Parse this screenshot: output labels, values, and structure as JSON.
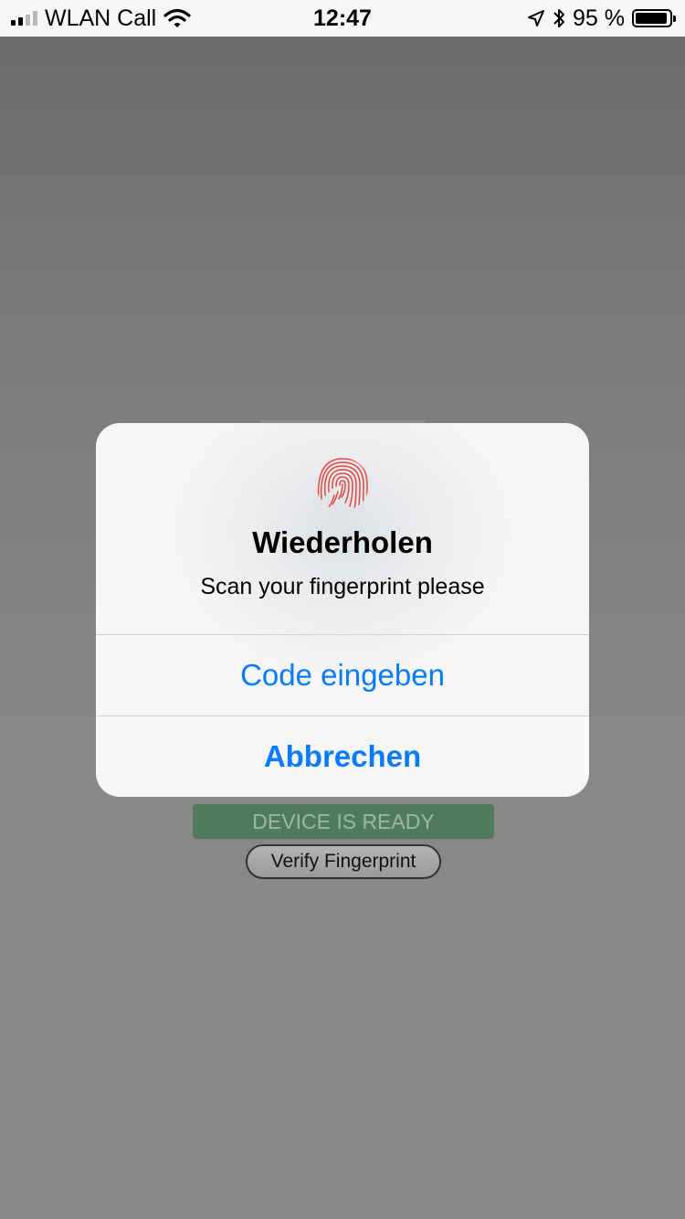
{
  "status_bar": {
    "carrier": "WLAN Call",
    "time": "12:47",
    "battery_percent": "95 %",
    "battery_level": 0.95,
    "signal_bars_filled": 2,
    "signal_bars_total": 4,
    "icons": [
      "signal-icon",
      "wifi-icon",
      "location-arrow-icon",
      "bluetooth-icon",
      "battery-icon"
    ]
  },
  "app": {
    "status_banner": "DEVICE IS READY",
    "verify_button_label": "Verify Fingerprint",
    "status_banner_color": "#4f7a5c"
  },
  "alert": {
    "icon": "fingerprint-icon",
    "icon_color": "#e2463c",
    "title": "Wiederholen",
    "message": "Scan your fingerprint please",
    "actions": [
      {
        "label": "Code eingeben",
        "style": "default"
      },
      {
        "label": "Abbrechen",
        "style": "bold"
      }
    ],
    "action_color": "#0a7aff"
  }
}
